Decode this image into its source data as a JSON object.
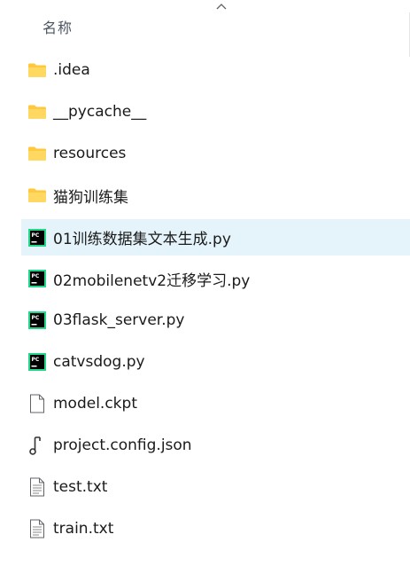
{
  "header": {
    "column_label": "名称"
  },
  "files": [
    {
      "name": ".idea",
      "icon": "folder-icon",
      "selected": false
    },
    {
      "name": "__pycache__",
      "icon": "folder-icon",
      "selected": false
    },
    {
      "name": "resources",
      "icon": "folder-icon",
      "selected": false
    },
    {
      "name": "猫狗训练集",
      "icon": "folder-icon",
      "selected": false
    },
    {
      "name": "01训练数据集文本生成.py",
      "icon": "pycharm-file-icon",
      "selected": true
    },
    {
      "name": "02mobilenetv2迁移学习.py",
      "icon": "pycharm-file-icon",
      "selected": false
    },
    {
      "name": "03flask_server.py",
      "icon": "pycharm-file-icon",
      "selected": false
    },
    {
      "name": "catvsdog.py",
      "icon": "pycharm-file-icon",
      "selected": false
    },
    {
      "name": "model.ckpt",
      "icon": "blank-file-icon",
      "selected": false
    },
    {
      "name": "project.config.json",
      "icon": "json-file-icon",
      "selected": false
    },
    {
      "name": "test.txt",
      "icon": "text-file-icon",
      "selected": false
    },
    {
      "name": "train.txt",
      "icon": "text-file-icon",
      "selected": false
    }
  ],
  "colors": {
    "selection": "#e5f3fb",
    "folder": "#ffc83d",
    "pycharm_bg": "#000000",
    "pycharm_accent": "#21d789"
  }
}
